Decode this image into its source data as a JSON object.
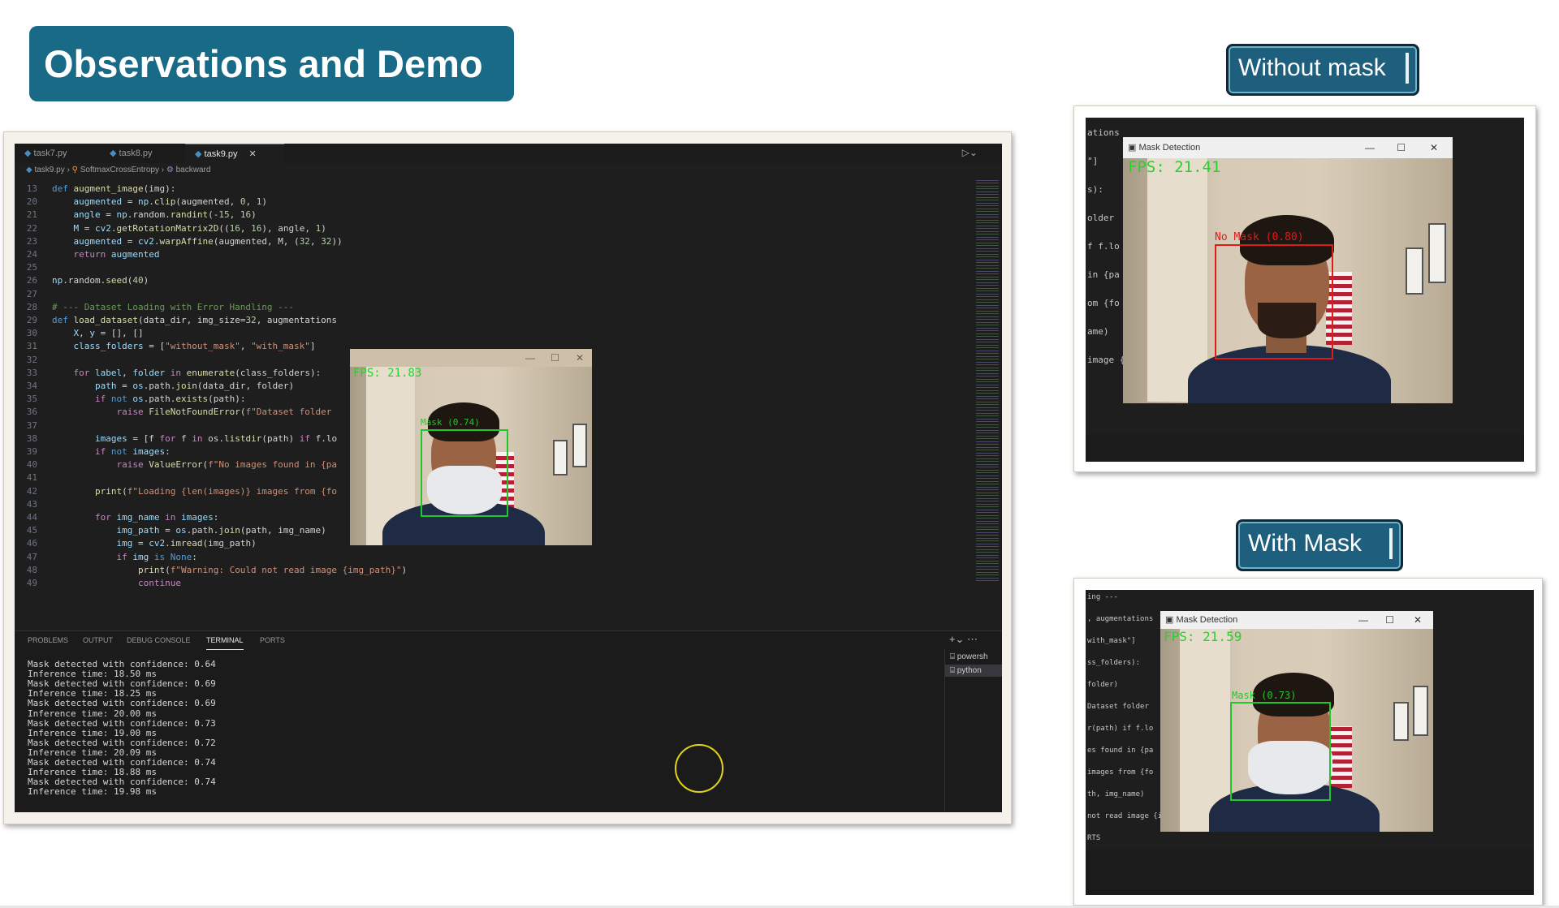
{
  "slide": {
    "title": "Observations and Demo",
    "label_without_mask": "Without mask",
    "label_with_mask": "With Mask"
  },
  "editor": {
    "tabs": [
      "task7.py",
      "task8.py",
      "task9.py"
    ],
    "active_tab": "task9.py",
    "breadcrumb": [
      "task9.py",
      "SoftmaxCrossEntropy",
      "backward"
    ],
    "code_lines": [
      {
        "n": "13",
        "html": "<span class='kw'>def</span> <span class='fn'>augment_image</span><span class='txt'>(img):</span>"
      },
      {
        "n": "20",
        "html": "    <span class='var'>augmented</span> <span class='txt'>=</span> <span class='var'>np</span><span class='txt'>.</span><span class='fn'>clip</span><span class='txt'>(augmented, </span><span class='num'>0</span><span class='txt'>, </span><span class='num'>1</span><span class='txt'>)</span>"
      },
      {
        "n": "21",
        "html": "    <span class='var'>angle</span> <span class='txt'>=</span> <span class='var'>np</span><span class='txt'>.random.</span><span class='fn'>randint</span><span class='txt'>(-</span><span class='num'>15</span><span class='txt'>, </span><span class='num'>16</span><span class='txt'>)</span>"
      },
      {
        "n": "22",
        "html": "    <span class='var'>M</span> <span class='txt'>=</span> <span class='var'>cv2</span><span class='txt'>.</span><span class='fn'>getRotationMatrix2D</span><span class='txt'>((</span><span class='num'>16</span><span class='txt'>, </span><span class='num'>16</span><span class='txt'>), angle, </span><span class='num'>1</span><span class='txt'>)</span>"
      },
      {
        "n": "23",
        "html": "    <span class='var'>augmented</span> <span class='txt'>=</span> <span class='var'>cv2</span><span class='txt'>.</span><span class='fn'>warpAffine</span><span class='txt'>(augmented, M, (</span><span class='num'>32</span><span class='txt'>, </span><span class='num'>32</span><span class='txt'>))</span>"
      },
      {
        "n": "24",
        "html": "    <span class='ctl'>return</span> <span class='var'>augmented</span>"
      },
      {
        "n": "25",
        "html": ""
      },
      {
        "n": "26",
        "html": "<span class='var'>np</span><span class='txt'>.random.</span><span class='fn'>seed</span><span class='txt'>(</span><span class='num'>40</span><span class='txt'>)</span>"
      },
      {
        "n": "27",
        "html": ""
      },
      {
        "n": "28",
        "html": "<span class='cm'># --- Dataset Loading with Error Handling ---</span>"
      },
      {
        "n": "29",
        "html": "<span class='kw'>def</span> <span class='fn'>load_dataset</span><span class='txt'>(data_dir, img_size=</span><span class='num'>32</span><span class='txt'>, augmentations</span>"
      },
      {
        "n": "30",
        "html": "    <span class='var'>X</span><span class='txt'>, </span><span class='var'>y</span> <span class='txt'>= [], []</span>"
      },
      {
        "n": "31",
        "html": "    <span class='var'>class_folders</span> <span class='txt'>= [</span><span class='str'>\"without_mask\"</span><span class='txt'>, </span><span class='str'>\"with_mask\"</span><span class='txt'>]</span>"
      },
      {
        "n": "32",
        "html": ""
      },
      {
        "n": "33",
        "html": "    <span class='ctl'>for</span> <span class='var'>label</span><span class='txt'>, </span><span class='var'>folder</span> <span class='ctl'>in</span> <span class='fn'>enumerate</span><span class='txt'>(class_folders):</span>"
      },
      {
        "n": "34",
        "html": "        <span class='var'>path</span> <span class='txt'>=</span> <span class='var'>os</span><span class='txt'>.path.</span><span class='fn'>join</span><span class='txt'>(data_dir, folder)</span>"
      },
      {
        "n": "35",
        "html": "        <span class='ctl'>if</span> <span class='kw'>not</span> <span class='var'>os</span><span class='txt'>.path.</span><span class='fn'>exists</span><span class='txt'>(path):</span>"
      },
      {
        "n": "36",
        "html": "            <span class='ctl'>raise</span> <span class='fn'>FileNotFoundError</span><span class='txt'>(</span><span class='str'>f\"Dataset folder</span>"
      },
      {
        "n": "37",
        "html": ""
      },
      {
        "n": "38",
        "html": "        <span class='var'>images</span> <span class='txt'>= [f </span><span class='ctl'>for</span><span class='txt'> f </span><span class='ctl'>in</span><span class='txt'> os.</span><span class='fn'>listdir</span><span class='txt'>(path) </span><span class='ctl'>if</span><span class='txt'> f.lo</span>"
      },
      {
        "n": "39",
        "html": "        <span class='ctl'>if</span> <span class='kw'>not</span> <span class='var'>images</span><span class='txt'>:</span>"
      },
      {
        "n": "40",
        "html": "            <span class='ctl'>raise</span> <span class='fn'>ValueError</span><span class='txt'>(</span><span class='str'>f\"No images found in {pa</span>"
      },
      {
        "n": "41",
        "html": ""
      },
      {
        "n": "42",
        "html": "        <span class='fn'>print</span><span class='txt'>(</span><span class='str'>f\"Loading {len(images)} images from {fo</span>"
      },
      {
        "n": "43",
        "html": ""
      },
      {
        "n": "44",
        "html": "        <span class='ctl'>for</span> <span class='var'>img_name</span> <span class='ctl'>in</span> <span class='var'>images</span><span class='txt'>:</span>"
      },
      {
        "n": "45",
        "html": "            <span class='var'>img_path</span> <span class='txt'>=</span> <span class='var'>os</span><span class='txt'>.path.</span><span class='fn'>join</span><span class='txt'>(path, img_name)</span>"
      },
      {
        "n": "46",
        "html": "            <span class='var'>img</span> <span class='txt'>=</span> <span class='var'>cv2</span><span class='txt'>.</span><span class='fn'>imread</span><span class='txt'>(img_path)</span>"
      },
      {
        "n": "47",
        "html": "            <span class='ctl'>if</span> <span class='var'>img</span> <span class='kw'>is</span> <span class='kw'>None</span><span class='txt'>:</span>"
      },
      {
        "n": "48",
        "html": "                <span class='fn'>print</span><span class='txt'>(</span><span class='str'>f\"Warning: Could not read image {img_path}\"</span><span class='txt'>)</span>"
      },
      {
        "n": "49",
        "html": "                <span class='ctl'>continue</span>"
      }
    ],
    "panel_tabs": [
      "PROBLEMS",
      "OUTPUT",
      "DEBUG CONSOLE",
      "TERMINAL",
      "PORTS"
    ],
    "active_panel_tab": "TERMINAL",
    "terminal_sessions": [
      "powersh",
      "python"
    ],
    "terminal_lines": [
      "Mask detected with confidence: 0.64",
      "Inference time: 18.50 ms",
      "Mask detected with confidence: 0.69",
      "Inference time: 18.25 ms",
      "Mask detected with confidence: 0.69",
      "Inference time: 20.00 ms",
      "Mask detected with confidence: 0.73",
      "Inference time: 19.00 ms",
      "Mask detected with confidence: 0.72",
      "Inference time: 20.09 ms",
      "Mask detected with confidence: 0.74",
      "Inference time: 18.88 ms",
      "Mask detected with confidence: 0.74",
      "Inference time: 19.98 ms"
    ]
  },
  "main_cam": {
    "fps": "FPS: 21.83",
    "box_label": "Mask (0.74)",
    "box_color": "#1fc82a"
  },
  "without_mask_demo": {
    "window_title": "Mask Detection",
    "fps": "FPS: 21.41",
    "box_label": "No Mask (0.80)",
    "box_color": "#e01b1b",
    "code_fragments": [
      "ations",
      "\"]",
      "s):",
      "older",
      "f f.lo",
      "in {pa",
      "om {fo",
      "ame)",
      "image {img_path}\")"
    ]
  },
  "with_mask_demo": {
    "window_title": "Mask Detection",
    "fps": "FPS: 21.59",
    "box_label": "Mask (0.73)",
    "box_color": "#1fc82a",
    "code_fragments": [
      "ing ---",
      ", augmentations",
      "with_mask\"]",
      "ss_folders):",
      "folder)",
      "Dataset folder",
      "r(path) if f.lo",
      "es found in {pa",
      "images from {fo",
      "th, img_name)",
      "not read image {img_path}\")",
      "RTS"
    ]
  }
}
